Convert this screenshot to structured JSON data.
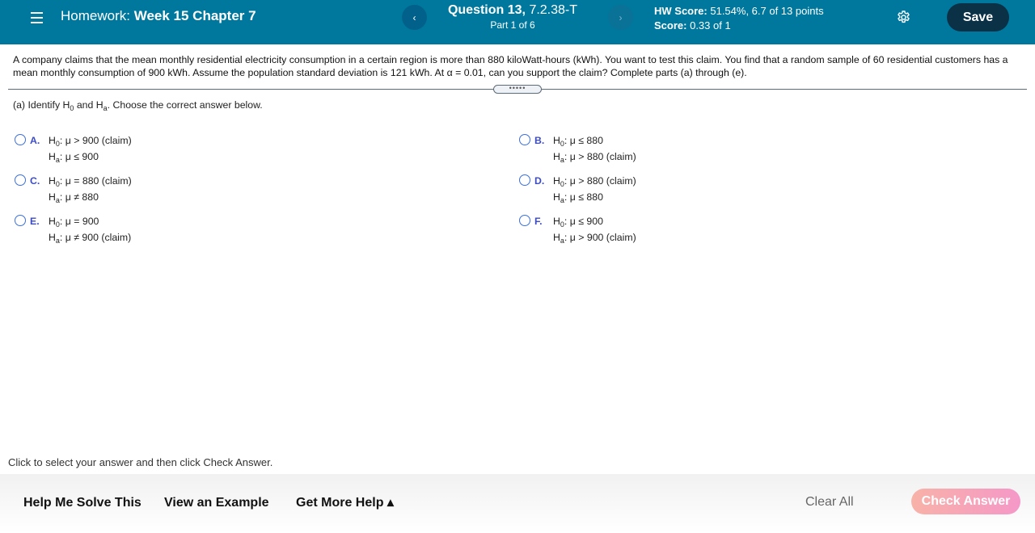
{
  "header": {
    "hw_prefix": "Homework:",
    "hw_name": "Week 15 Chapter 7",
    "question_label": "Question 13,",
    "question_id": "7.2.38-T",
    "part": "Part 1 of 6",
    "hw_score_label": "HW Score:",
    "hw_score_value": "51.54%, 6.7 of 13 points",
    "score_label": "Score:",
    "score_value": "0.33 of 1",
    "save_label": "Save",
    "prev_glyph": "‹",
    "next_glyph": "›",
    "icons": {
      "menu": "hamburger-menu-icon",
      "settings": "gear-icon"
    },
    "colors": {
      "bar": "#00789e",
      "save_button": "#0b3147"
    }
  },
  "problem": {
    "text": "A company claims that the mean monthly residential electricity consumption in a certain region is more than 880 kiloWatt-hours (kWh). You want to test this claim. You find that a random sample of 60 residential customers has a mean monthly consumption of 900 kWh. Assume the population standard deviation is 121 kWh. At α = 0.01, can you support the claim? Complete parts (a) through (e).",
    "expand_glyph": "•••••"
  },
  "part_a": {
    "prompt_start": "(a) Identify H",
    "sub0": "0",
    "prompt_mid": " and H",
    "suba": "a",
    "prompt_end": ". Choose the correct answer below.",
    "choices": [
      {
        "letter": "A.",
        "h0": "μ > 900 (claim)",
        "ha": "μ ≤ 900"
      },
      {
        "letter": "B.",
        "h0": "μ ≤ 880",
        "ha": "μ > 880 (claim)"
      },
      {
        "letter": "C.",
        "h0": "μ = 880 (claim)",
        "ha": "μ ≠ 880"
      },
      {
        "letter": "D.",
        "h0": "μ > 880 (claim)",
        "ha": "μ ≤ 880"
      },
      {
        "letter": "E.",
        "h0": "μ = 900",
        "ha": "μ ≠ 900 (claim)"
      },
      {
        "letter": "F.",
        "h0": "μ ≤ 900",
        "ha": "μ > 900 (claim)"
      }
    ]
  },
  "instruction": "Click to select your answer and then click Check Answer.",
  "footer": {
    "help_solve": "Help Me Solve This",
    "view_example": "View an Example",
    "more_help": "Get More Help ▴",
    "clear_all": "Clear All",
    "check_answer": "Check Answer"
  }
}
